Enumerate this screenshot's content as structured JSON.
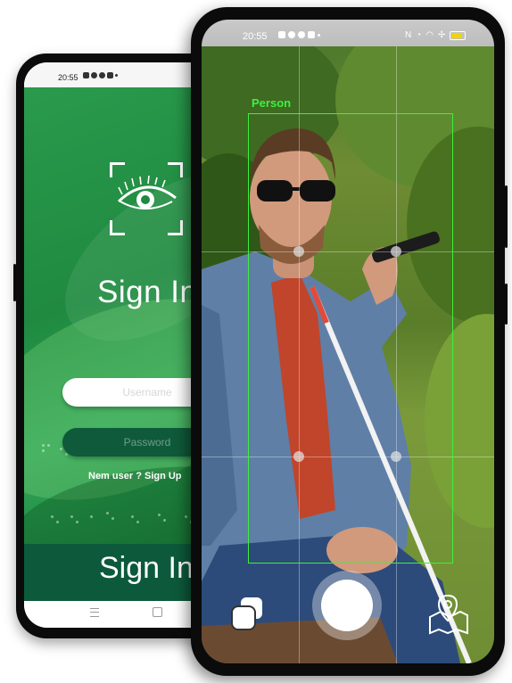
{
  "back_phone": {
    "status_time": "20:55",
    "title": "Sign In",
    "username_placeholder": "Username",
    "password_placeholder": "Password",
    "new_user_text": "Nem user",
    "sign_up_link": "? Sign Up",
    "bottom_button": "Sign In",
    "colors": {
      "green": "#2a9a4c",
      "dark_green": "#0c5a3b"
    }
  },
  "front_phone": {
    "status_time": "20:55",
    "detection_label": "Person",
    "colors": {
      "detection": "#3ef03e"
    },
    "icons": [
      "gallery-icon",
      "shutter-button",
      "map-pin-icon"
    ]
  }
}
